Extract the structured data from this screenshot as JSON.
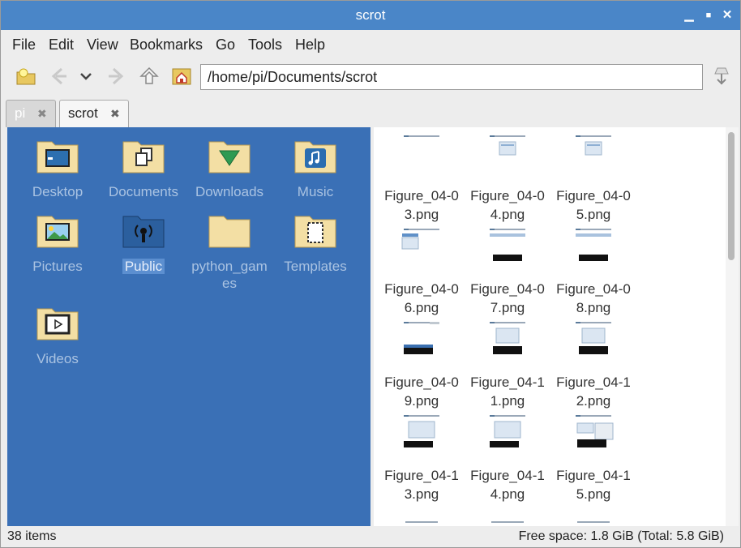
{
  "window": {
    "title": "scrot"
  },
  "menu": [
    "File",
    "Edit",
    "View",
    "Bookmarks",
    "Go",
    "Tools",
    "Help"
  ],
  "address": {
    "path": "/home/pi/Documents/scrot"
  },
  "tabs": [
    {
      "label": "pi",
      "close": "✖"
    },
    {
      "label": "scrot",
      "close": "✖"
    }
  ],
  "sidebar": {
    "folders": [
      {
        "line1": "Desktop",
        "icon": "desktop-icon"
      },
      {
        "line1": "Documents",
        "icon": "documents-icon"
      },
      {
        "line1": "Downloads",
        "icon": "downloads-icon"
      },
      {
        "line1": "Music",
        "icon": "music-icon"
      },
      {
        "line1": "Pictures",
        "icon": "pictures-icon"
      },
      {
        "line1": "Public",
        "icon": "public-icon",
        "selected": true
      },
      {
        "line1": "python_gam",
        "line2": "es",
        "icon": "folder-icon"
      },
      {
        "line1": "Templates",
        "icon": "templates-icon"
      },
      {
        "line1": "Videos",
        "icon": "videos-icon"
      }
    ]
  },
  "files": [
    {
      "line1": "Figure_04-0",
      "line2": "3.png"
    },
    {
      "line1": "Figure_04-0",
      "line2": "4.png"
    },
    {
      "line1": "Figure_04-0",
      "line2": "5.png"
    },
    {
      "line1": "Figure_04-0",
      "line2": "6.png"
    },
    {
      "line1": "Figure_04-0",
      "line2": "7.png"
    },
    {
      "line1": "Figure_04-0",
      "line2": "8.png"
    },
    {
      "line1": "Figure_04-0",
      "line2": "9.png"
    },
    {
      "line1": "Figure_04-1",
      "line2": "1.png"
    },
    {
      "line1": "Figure_04-1",
      "line2": "2.png"
    },
    {
      "line1": "Figure_04-1",
      "line2": "3.png"
    },
    {
      "line1": "Figure_04-1",
      "line2": "4.png"
    },
    {
      "line1": "Figure_04-1",
      "line2": "5.png"
    }
  ],
  "status": {
    "count": "38 items",
    "space": "Free space: 1.8 GiB (Total: 5.8 GiB)"
  },
  "colors": {
    "titlebar": "#4a86c8",
    "sidepane": "#3a70b6",
    "folder": "#f3dfa4"
  }
}
